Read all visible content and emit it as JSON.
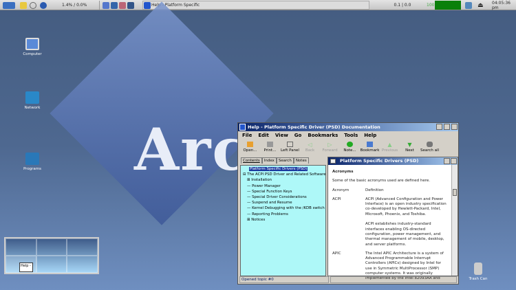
{
  "taskbar": {
    "cpu_label": "1.4% / 0.0%",
    "task_label": "Help - Platform Specific",
    "load_label": "0.1 | 0.0",
    "mem_label": "100",
    "clock": "04:05:36 pm"
  },
  "desktop": {
    "logo_text": "Arc",
    "icons": [
      {
        "label": "Computer"
      },
      {
        "label": "Network"
      },
      {
        "label": "Programs"
      },
      {
        "label": "Trash Can"
      }
    ],
    "pager_window_label": "Help -"
  },
  "window": {
    "title": "Help - Platform Specific Driver (PSD) Documentation",
    "menu": [
      "File",
      "Edit",
      "View",
      "Go",
      "Bookmarks",
      "Tools",
      "Help"
    ],
    "toolbar": [
      {
        "label": "Open...",
        "enabled": true
      },
      {
        "label": "Print...",
        "enabled": true
      },
      {
        "label": "Left Panel",
        "enabled": true
      },
      {
        "label": "Back",
        "enabled": false
      },
      {
        "label": "Forward",
        "enabled": false
      },
      {
        "label": "Note...",
        "enabled": true
      },
      {
        "label": "Bookmark",
        "enabled": true
      },
      {
        "label": "Previous",
        "enabled": false
      },
      {
        "label": "Next",
        "enabled": true
      },
      {
        "label": "Search all",
        "enabled": true
      }
    ],
    "tabs": [
      "Contents",
      "Index",
      "Search",
      "Notes"
    ],
    "tree": [
      {
        "label": "Platform Specific Drivers (PSD)",
        "level": 0,
        "selected": true
      },
      {
        "label": "The ACPI PSD Driver and Related Software",
        "level": 0
      },
      {
        "label": "Installation",
        "level": 1,
        "expand": true
      },
      {
        "label": "Power Manager",
        "level": 1
      },
      {
        "label": "Special Function Keys",
        "level": 1
      },
      {
        "label": "Special Driver Considerations",
        "level": 1
      },
      {
        "label": "Suspend and Resume",
        "level": 1
      },
      {
        "label": "Kernel Debugging with the /KDB switch",
        "level": 1
      },
      {
        "label": "Reporting Problems",
        "level": 1
      },
      {
        "label": "Notices",
        "level": 1,
        "expand": true
      }
    ],
    "pane_title": "Platform Specific Drivers (PSD)",
    "content": {
      "heading": "Acronyms",
      "intro": "Some of the basic acronyms used are defined here.",
      "col1": "Acronym",
      "col2": "Definition",
      "rows": [
        {
          "term": "ACPI",
          "def": "ACPI (Advanced Configuration and Power Interface) is an open industry specification co-developed by Hewlett-Packard, Intel, Microsoft, Phoenix, and Toshiba.",
          "def2": "ACPI establishes industry-standard interfaces enabling OS-directed configuration, power management, and thermal management of mobile, desktop, and server platforms."
        },
        {
          "term": "APIC",
          "def": "The Intel APIC Architecture is a system of Advanced Programmable Interrupt Controllers (APICs) designed by Intel for use in Symmetric MultiProcessor (SMP) computer systems. It was originally implemented by the Intel 82093AA and"
        }
      ]
    },
    "status": "Opened topic #0"
  }
}
